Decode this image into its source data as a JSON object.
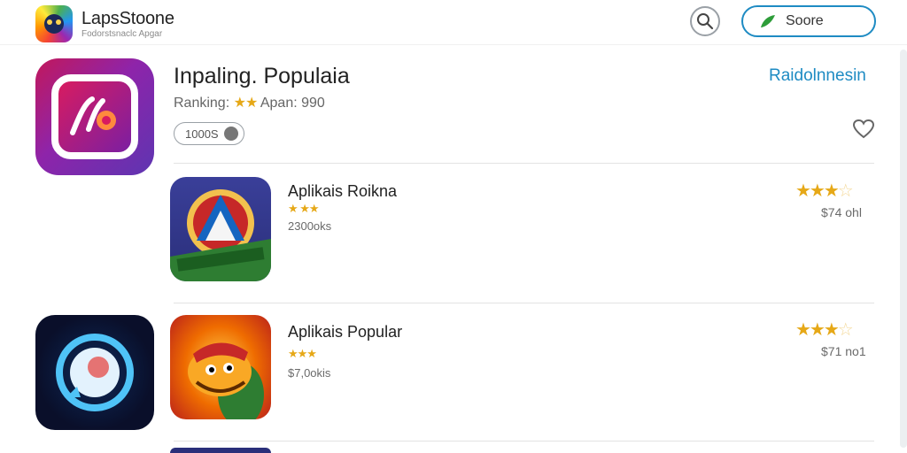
{
  "header": {
    "brand_title": "LapsStoone",
    "brand_subtitle": "Fodorstsnaclc Apgar",
    "store_button_label": "Soore"
  },
  "featured": {
    "title": "Inpaling. Populaia",
    "ranking_prefix": "Ranking:",
    "ranking_stars": "★★",
    "ranking_suffix": "Apan: 990",
    "chip_label": "1000S",
    "see_all_label": "Raidolnnesin"
  },
  "apps": [
    {
      "name": "Aplikais Roikna",
      "stars": "★ ★★",
      "meta": "2300oks",
      "rating_stars": "★★★",
      "rating_empty": "☆",
      "price": "$74 ohl"
    },
    {
      "name": "Aplikais Popular",
      "stars": "★★★",
      "meta": "$7,0okis",
      "rating_stars": "★★★",
      "rating_empty": "☆",
      "price": "$71 no1"
    }
  ],
  "colors": {
    "accent": "#1e8bc3",
    "star": "#e6a817"
  },
  "icons": [
    "app-store-logo-icon",
    "search-icon",
    "leaf-icon",
    "heart-icon",
    "globe-icon"
  ]
}
